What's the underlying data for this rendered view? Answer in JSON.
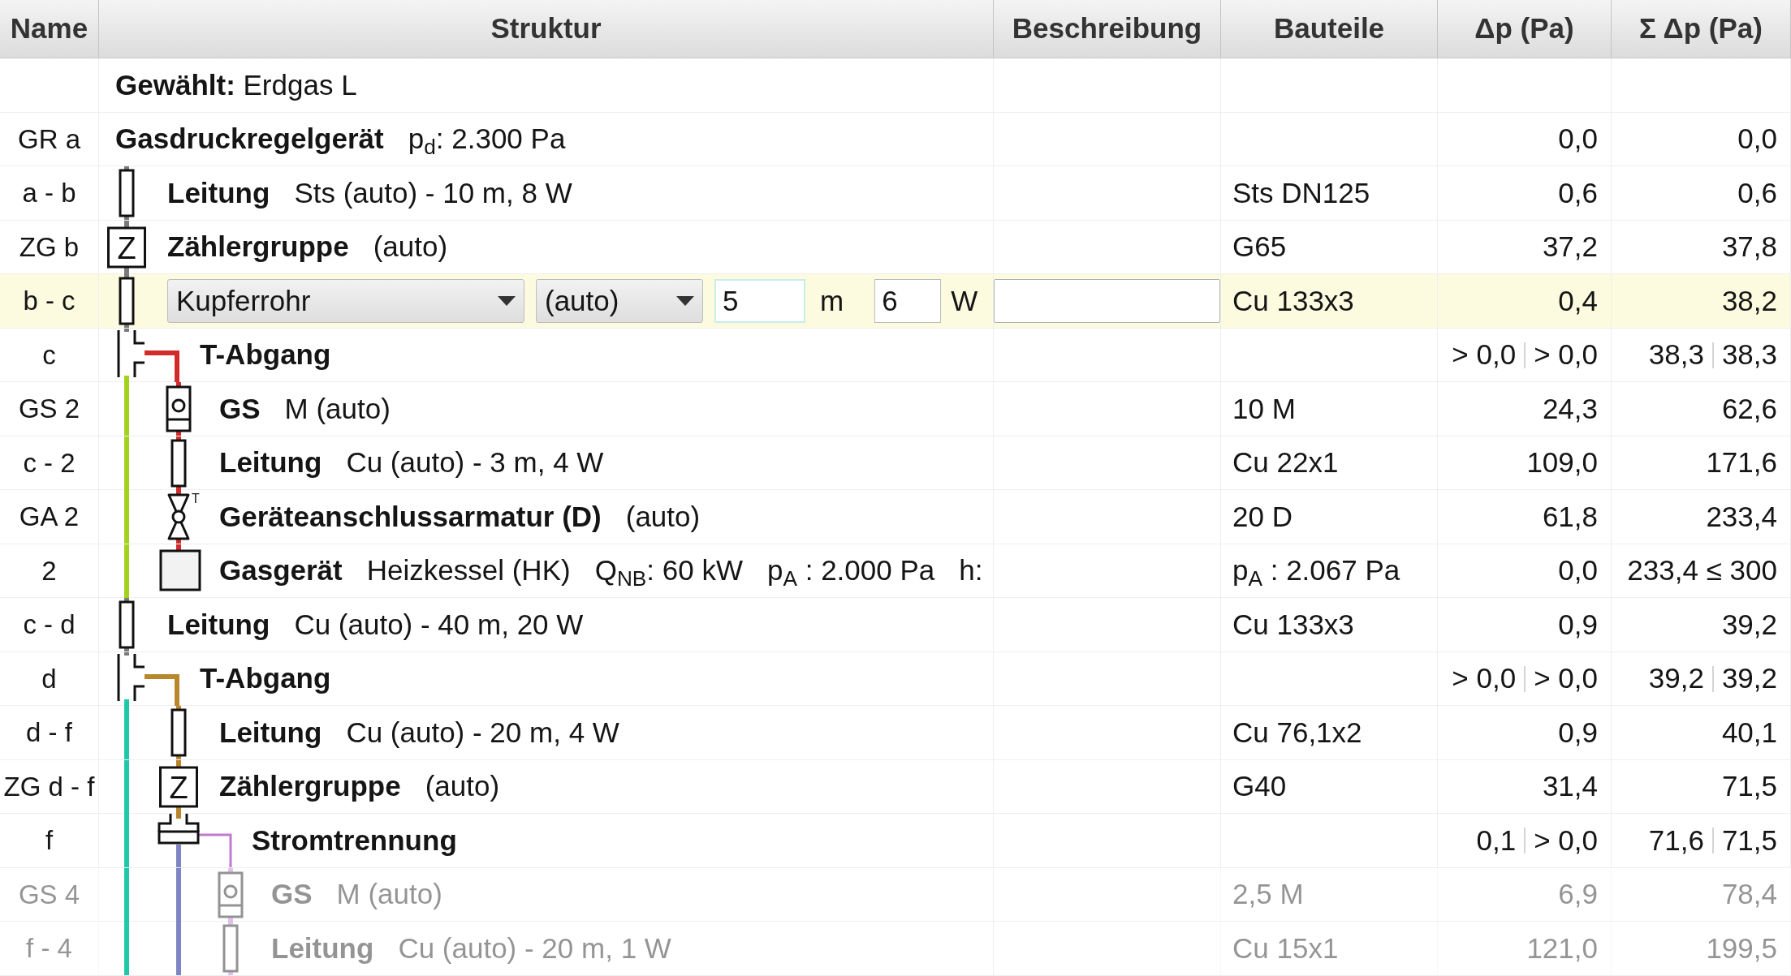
{
  "columns": [
    "Name",
    "Struktur",
    "Beschreibung",
    "Bauteile",
    "Δp (Pa)",
    "Σ Δp (Pa)"
  ],
  "rows": [
    {
      "kind": "label",
      "selected": false,
      "label": "**Gewählt:** Erdgas L"
    },
    {
      "kind": "regulator",
      "selected": false,
      "name": "GR a",
      "title": "Gasdruckregelgerät",
      "details": [
        "p$_{d}$: 2.300 Pa"
      ],
      "dp": "0,0",
      "sum": "0,0"
    },
    {
      "kind": "pipe",
      "selected": false,
      "name": "a - b",
      "title": "Leitung",
      "details": [
        "Sts (auto) - 10 m, 8 W"
      ],
      "parts": "Sts DN125",
      "dp": "0,6",
      "sum": "0,6"
    },
    {
      "kind": "meter",
      "selected": false,
      "name": "ZG b",
      "icon_text": "Z",
      "title": "Zählergruppe",
      "details": [
        "(auto)"
      ],
      "parts": "G65",
      "dp": "37,2",
      "sum": "37,8"
    },
    {
      "kind": "pipe",
      "selected": true,
      "name": "b - c",
      "editor": {
        "material": "Kupferrohr",
        "size": "(auto)",
        "length": "5",
        "length_unit": "m",
        "fittings": "6",
        "fittings_unit": "W"
      },
      "parts": "Cu 133x3",
      "dp": "0,4",
      "sum": "38,2"
    },
    {
      "kind": "tee",
      "selected": false,
      "name": "c",
      "title": "T-Abgang",
      "branch_line": {
        "color": "#d22b2b"
      },
      "main_line": {
        "color": "#a2d21c"
      },
      "dp": [
        "> 0,0",
        "> 0,0"
      ],
      "sum": [
        "38,3",
        "38,3"
      ],
      "children": [
        {
          "kind": "gs",
          "selected": false,
          "name": "GS 2",
          "title": "GS",
          "details": [
            "M (auto)"
          ],
          "parts": "10 M",
          "dp": "24,3",
          "sum": "62,6"
        },
        {
          "kind": "pipe",
          "selected": false,
          "name": "c - 2",
          "title": "Leitung",
          "details": [
            "Cu (auto) - 3 m, 4 W"
          ],
          "parts": "Cu 22x1",
          "dp": "109,0",
          "sum": "171,6"
        },
        {
          "kind": "valve",
          "selected": false,
          "name": "GA 2",
          "icon_text": "T",
          "title": "Geräteanschlussarmatur (D)",
          "details": [
            "(auto)"
          ],
          "parts": "20 D",
          "dp": "61,8",
          "sum": "233,4"
        },
        {
          "kind": "appliance",
          "selected": false,
          "name": "2",
          "title": "Gasgerät",
          "details": [
            "Heizkessel (HK)",
            "Q$_{NB}$: 60 kW",
            "p$_{A}$ : 2.000 Pa",
            "h:"
          ],
          "parts": "p$_{A}$ : 2.067 Pa",
          "dp": "0,0",
          "sum": "233,4 ≤ 300"
        }
      ]
    },
    {
      "kind": "pipe",
      "selected": false,
      "name": "c - d",
      "title": "Leitung",
      "details": [
        "Cu (auto) - 40 m, 20 W"
      ],
      "parts": "Cu 133x3",
      "dp": "0,9",
      "sum": "39,2"
    },
    {
      "kind": "tee",
      "selected": false,
      "name": "d",
      "title": "T-Abgang",
      "branch_line": {
        "color": "#b8862b"
      },
      "main_line": {
        "color": "#1fc9a8"
      },
      "dp": [
        "> 0,0",
        "> 0,0"
      ],
      "sum": [
        "39,2",
        "39,2"
      ],
      "children": [
        {
          "kind": "pipe",
          "selected": false,
          "name": "d - f",
          "title": "Leitung",
          "details": [
            "Cu (auto) - 20 m, 4 W"
          ],
          "parts": "Cu 76,1x2",
          "dp": "0,9",
          "sum": "40,1"
        },
        {
          "kind": "meter",
          "selected": false,
          "name": "ZG d - f",
          "icon_text": "Z",
          "title": "Zählergruppe",
          "details": [
            "(auto)"
          ],
          "parts": "G40",
          "dp": "31,4",
          "sum": "71,5"
        },
        {
          "kind": "separator",
          "selected": false,
          "name": "f",
          "title": "Stromtrennung",
          "branch_line": {
            "color": "#c07ad0"
          },
          "main_line": {
            "color": "#7f84c4"
          },
          "dp": [
            "0,1",
            "> 0,0"
          ],
          "sum": [
            "71,6",
            "71,5"
          ],
          "children": [
            {
              "kind": "gs",
              "selected": false,
              "greyed": true,
              "name": "GS 4",
              "title": "GS",
              "details": [
                "M (auto)"
              ],
              "parts": "2,5 M",
              "dp": "6,9",
              "sum": "78,4"
            },
            {
              "kind": "pipe",
              "selected": false,
              "greyed": true,
              "name": "f - 4",
              "title": "Leitung",
              "details": [
                "Cu (auto) - 20 m, 1 W"
              ],
              "parts": "Cu 15x1",
              "dp": "121,0",
              "sum": "199,5"
            }
          ]
        }
      ]
    }
  ]
}
